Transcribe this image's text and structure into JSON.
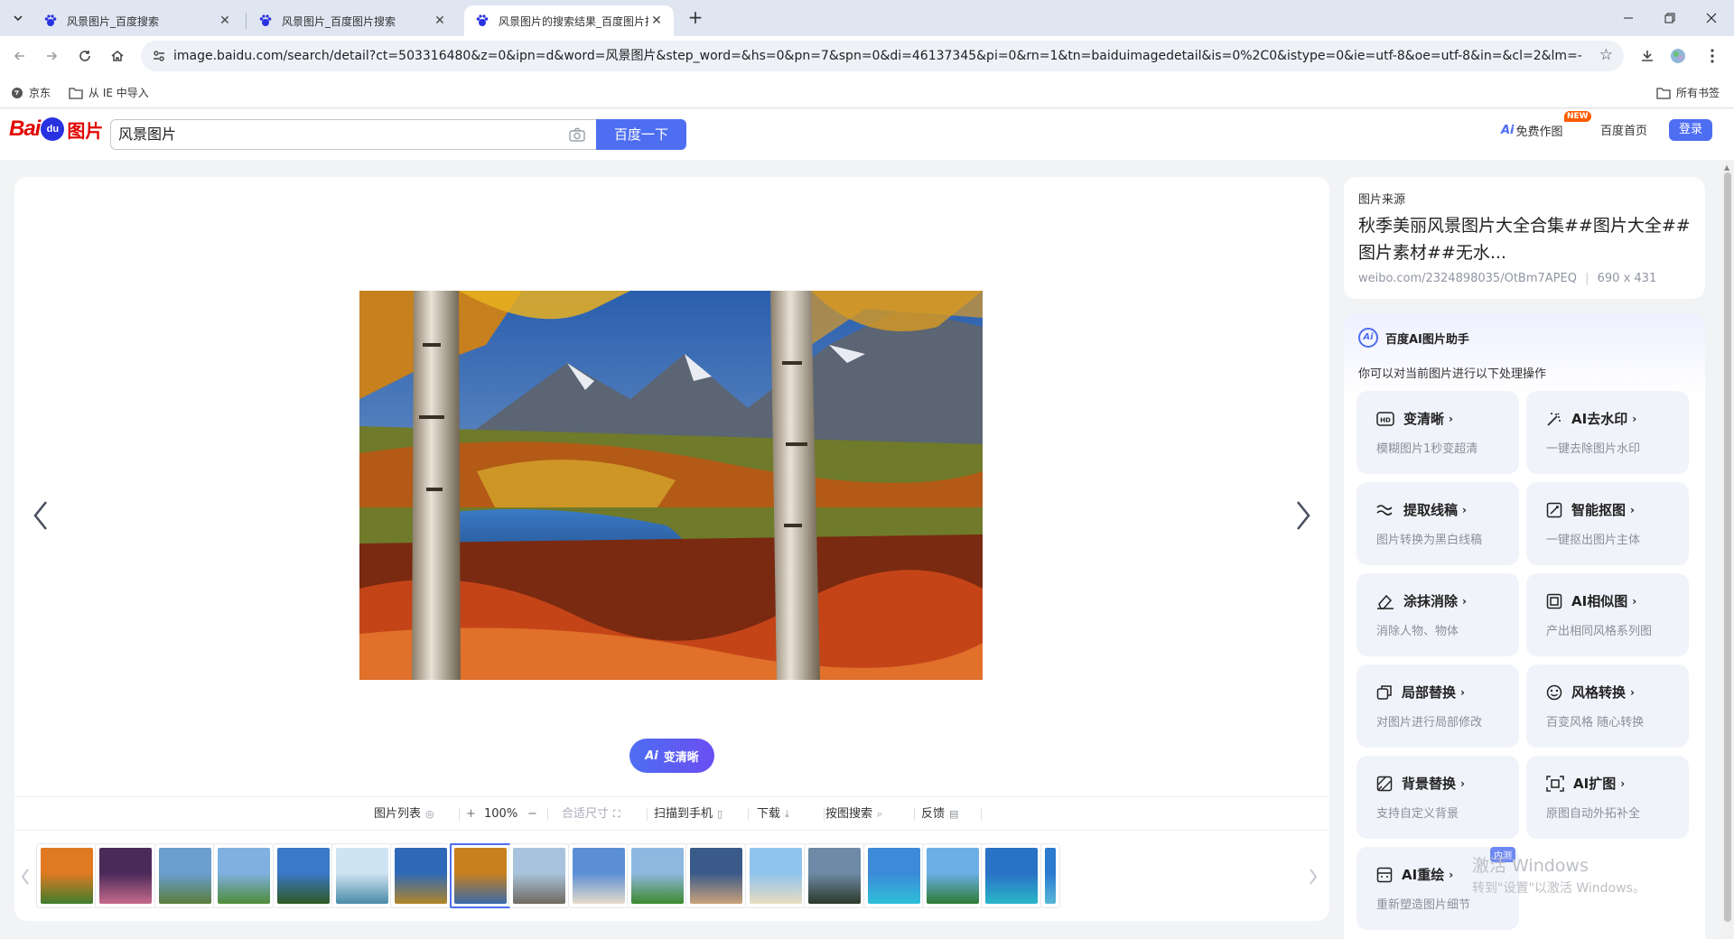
{
  "browser": {
    "tabs": [
      {
        "title": "风景图片_百度搜索",
        "active": false
      },
      {
        "title": "风景图片_百度图片搜索",
        "active": false
      },
      {
        "title": "风景图片的搜索结果_百度图片搜索",
        "active": true
      }
    ],
    "url": "image.baidu.com/search/detail?ct=503316480&z=0&ipn=d&word=风景图片&step_word=&hs=0&pn=7&spn=0&di=46137345&pi=0&rn=1&tn=baiduimagedetail&is=0%2C0&istype=0&ie=utf-8&oe=utf-8&in=&cl=2&lm=-1&st=...",
    "bookmarks": [
      {
        "label": "京东"
      },
      {
        "label": "从 IE 中导入"
      }
    ],
    "all_bookmarks": "所有书签"
  },
  "header": {
    "logo_left": "Bai",
    "logo_paw": "du",
    "logo_right": "图片",
    "query": "风景图片",
    "search_button": "百度一下",
    "ai_draw_prefix": "Ai",
    "ai_draw": "免费作图",
    "new_badge": "NEW",
    "home": "百度首页",
    "login": "登录"
  },
  "viewer": {
    "ai_button_prefix": "Ai",
    "ai_button": "变清晰",
    "tools": [
      {
        "label": "图片列表"
      },
      {
        "label": "100%"
      },
      {
        "label": "合适尺寸"
      },
      {
        "label": "扫描到手机"
      },
      {
        "label": "下载"
      },
      {
        "label": "按图搜索"
      },
      {
        "label": "反馈"
      }
    ],
    "zoom_in": "+",
    "zoom_out": "−",
    "thumbnails_count": 18,
    "selected_thumbnail": 8
  },
  "source": {
    "label": "图片来源",
    "title": "秋季美丽风景图片大全合集##图片大全##图片素材##无水...",
    "url": "weibo.com/2324898035/OtBm7APEQ",
    "size": "690 x 431"
  },
  "ai_panel": {
    "logo": "Ai",
    "title": "百度AI图片助手",
    "subtitle": "你可以对当前图片进行以下处理操作",
    "tools": [
      {
        "name": "变清晰",
        "desc": "模糊图片1秒变超清",
        "icon": "hd-icon"
      },
      {
        "name": "AI去水印",
        "desc": "一键去除图片水印",
        "icon": "magic-wand-icon"
      },
      {
        "name": "提取线稿",
        "desc": "图片转换为黑白线稿",
        "icon": "line-art-icon"
      },
      {
        "name": "智能抠图",
        "desc": "一键抠出图片主体",
        "icon": "cutout-icon"
      },
      {
        "name": "涂抹消除",
        "desc": "消除人物、物体",
        "icon": "eraser-icon"
      },
      {
        "name": "AI相似图",
        "desc": "产出相同风格系列图",
        "icon": "similar-icon"
      },
      {
        "name": "局部替换",
        "desc": "对图片进行局部修改",
        "icon": "partial-replace-icon"
      },
      {
        "name": "风格转换",
        "desc": "百变风格 随心转换",
        "icon": "style-icon"
      },
      {
        "name": "背景替换",
        "desc": "支持自定义背景",
        "icon": "background-icon"
      },
      {
        "name": "AI扩图",
        "desc": "原图自动外拓补全",
        "icon": "expand-icon"
      },
      {
        "name": "AI重绘",
        "desc": "重新塑造图片细节",
        "icon": "redraw-icon"
      }
    ]
  },
  "overlay": {
    "badge": "内测",
    "activate_title": "激活 Windows",
    "activate_sub": "转到\"设置\"以激活 Windows。"
  },
  "colors": {
    "accent": "#4e6ef2",
    "baidu_red": "#e10601",
    "new_badge": "#ff5c00"
  }
}
